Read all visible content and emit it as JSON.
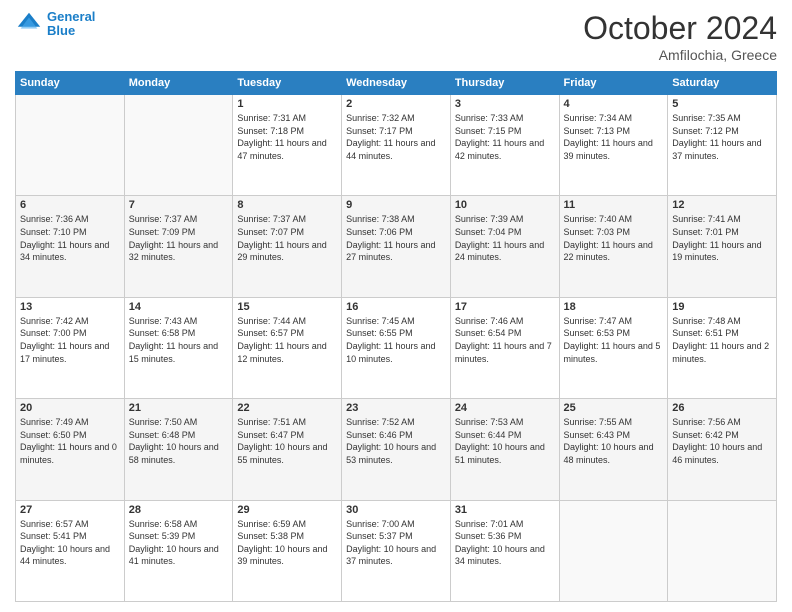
{
  "header": {
    "logo_line1": "General",
    "logo_line2": "Blue",
    "month": "October 2024",
    "location": "Amfilochia, Greece"
  },
  "days_of_week": [
    "Sunday",
    "Monday",
    "Tuesday",
    "Wednesday",
    "Thursday",
    "Friday",
    "Saturday"
  ],
  "weeks": [
    [
      {
        "day": "",
        "sunrise": "",
        "sunset": "",
        "daylight": ""
      },
      {
        "day": "",
        "sunrise": "",
        "sunset": "",
        "daylight": ""
      },
      {
        "day": "1",
        "sunrise": "Sunrise: 7:31 AM",
        "sunset": "Sunset: 7:18 PM",
        "daylight": "Daylight: 11 hours and 47 minutes."
      },
      {
        "day": "2",
        "sunrise": "Sunrise: 7:32 AM",
        "sunset": "Sunset: 7:17 PM",
        "daylight": "Daylight: 11 hours and 44 minutes."
      },
      {
        "day": "3",
        "sunrise": "Sunrise: 7:33 AM",
        "sunset": "Sunset: 7:15 PM",
        "daylight": "Daylight: 11 hours and 42 minutes."
      },
      {
        "day": "4",
        "sunrise": "Sunrise: 7:34 AM",
        "sunset": "Sunset: 7:13 PM",
        "daylight": "Daylight: 11 hours and 39 minutes."
      },
      {
        "day": "5",
        "sunrise": "Sunrise: 7:35 AM",
        "sunset": "Sunset: 7:12 PM",
        "daylight": "Daylight: 11 hours and 37 minutes."
      }
    ],
    [
      {
        "day": "6",
        "sunrise": "Sunrise: 7:36 AM",
        "sunset": "Sunset: 7:10 PM",
        "daylight": "Daylight: 11 hours and 34 minutes."
      },
      {
        "day": "7",
        "sunrise": "Sunrise: 7:37 AM",
        "sunset": "Sunset: 7:09 PM",
        "daylight": "Daylight: 11 hours and 32 minutes."
      },
      {
        "day": "8",
        "sunrise": "Sunrise: 7:37 AM",
        "sunset": "Sunset: 7:07 PM",
        "daylight": "Daylight: 11 hours and 29 minutes."
      },
      {
        "day": "9",
        "sunrise": "Sunrise: 7:38 AM",
        "sunset": "Sunset: 7:06 PM",
        "daylight": "Daylight: 11 hours and 27 minutes."
      },
      {
        "day": "10",
        "sunrise": "Sunrise: 7:39 AM",
        "sunset": "Sunset: 7:04 PM",
        "daylight": "Daylight: 11 hours and 24 minutes."
      },
      {
        "day": "11",
        "sunrise": "Sunrise: 7:40 AM",
        "sunset": "Sunset: 7:03 PM",
        "daylight": "Daylight: 11 hours and 22 minutes."
      },
      {
        "day": "12",
        "sunrise": "Sunrise: 7:41 AM",
        "sunset": "Sunset: 7:01 PM",
        "daylight": "Daylight: 11 hours and 19 minutes."
      }
    ],
    [
      {
        "day": "13",
        "sunrise": "Sunrise: 7:42 AM",
        "sunset": "Sunset: 7:00 PM",
        "daylight": "Daylight: 11 hours and 17 minutes."
      },
      {
        "day": "14",
        "sunrise": "Sunrise: 7:43 AM",
        "sunset": "Sunset: 6:58 PM",
        "daylight": "Daylight: 11 hours and 15 minutes."
      },
      {
        "day": "15",
        "sunrise": "Sunrise: 7:44 AM",
        "sunset": "Sunset: 6:57 PM",
        "daylight": "Daylight: 11 hours and 12 minutes."
      },
      {
        "day": "16",
        "sunrise": "Sunrise: 7:45 AM",
        "sunset": "Sunset: 6:55 PM",
        "daylight": "Daylight: 11 hours and 10 minutes."
      },
      {
        "day": "17",
        "sunrise": "Sunrise: 7:46 AM",
        "sunset": "Sunset: 6:54 PM",
        "daylight": "Daylight: 11 hours and 7 minutes."
      },
      {
        "day": "18",
        "sunrise": "Sunrise: 7:47 AM",
        "sunset": "Sunset: 6:53 PM",
        "daylight": "Daylight: 11 hours and 5 minutes."
      },
      {
        "day": "19",
        "sunrise": "Sunrise: 7:48 AM",
        "sunset": "Sunset: 6:51 PM",
        "daylight": "Daylight: 11 hours and 2 minutes."
      }
    ],
    [
      {
        "day": "20",
        "sunrise": "Sunrise: 7:49 AM",
        "sunset": "Sunset: 6:50 PM",
        "daylight": "Daylight: 11 hours and 0 minutes."
      },
      {
        "day": "21",
        "sunrise": "Sunrise: 7:50 AM",
        "sunset": "Sunset: 6:48 PM",
        "daylight": "Daylight: 10 hours and 58 minutes."
      },
      {
        "day": "22",
        "sunrise": "Sunrise: 7:51 AM",
        "sunset": "Sunset: 6:47 PM",
        "daylight": "Daylight: 10 hours and 55 minutes."
      },
      {
        "day": "23",
        "sunrise": "Sunrise: 7:52 AM",
        "sunset": "Sunset: 6:46 PM",
        "daylight": "Daylight: 10 hours and 53 minutes."
      },
      {
        "day": "24",
        "sunrise": "Sunrise: 7:53 AM",
        "sunset": "Sunset: 6:44 PM",
        "daylight": "Daylight: 10 hours and 51 minutes."
      },
      {
        "day": "25",
        "sunrise": "Sunrise: 7:55 AM",
        "sunset": "Sunset: 6:43 PM",
        "daylight": "Daylight: 10 hours and 48 minutes."
      },
      {
        "day": "26",
        "sunrise": "Sunrise: 7:56 AM",
        "sunset": "Sunset: 6:42 PM",
        "daylight": "Daylight: 10 hours and 46 minutes."
      }
    ],
    [
      {
        "day": "27",
        "sunrise": "Sunrise: 6:57 AM",
        "sunset": "Sunset: 5:41 PM",
        "daylight": "Daylight: 10 hours and 44 minutes."
      },
      {
        "day": "28",
        "sunrise": "Sunrise: 6:58 AM",
        "sunset": "Sunset: 5:39 PM",
        "daylight": "Daylight: 10 hours and 41 minutes."
      },
      {
        "day": "29",
        "sunrise": "Sunrise: 6:59 AM",
        "sunset": "Sunset: 5:38 PM",
        "daylight": "Daylight: 10 hours and 39 minutes."
      },
      {
        "day": "30",
        "sunrise": "Sunrise: 7:00 AM",
        "sunset": "Sunset: 5:37 PM",
        "daylight": "Daylight: 10 hours and 37 minutes."
      },
      {
        "day": "31",
        "sunrise": "Sunrise: 7:01 AM",
        "sunset": "Sunset: 5:36 PM",
        "daylight": "Daylight: 10 hours and 34 minutes."
      },
      {
        "day": "",
        "sunrise": "",
        "sunset": "",
        "daylight": ""
      },
      {
        "day": "",
        "sunrise": "",
        "sunset": "",
        "daylight": ""
      }
    ]
  ]
}
